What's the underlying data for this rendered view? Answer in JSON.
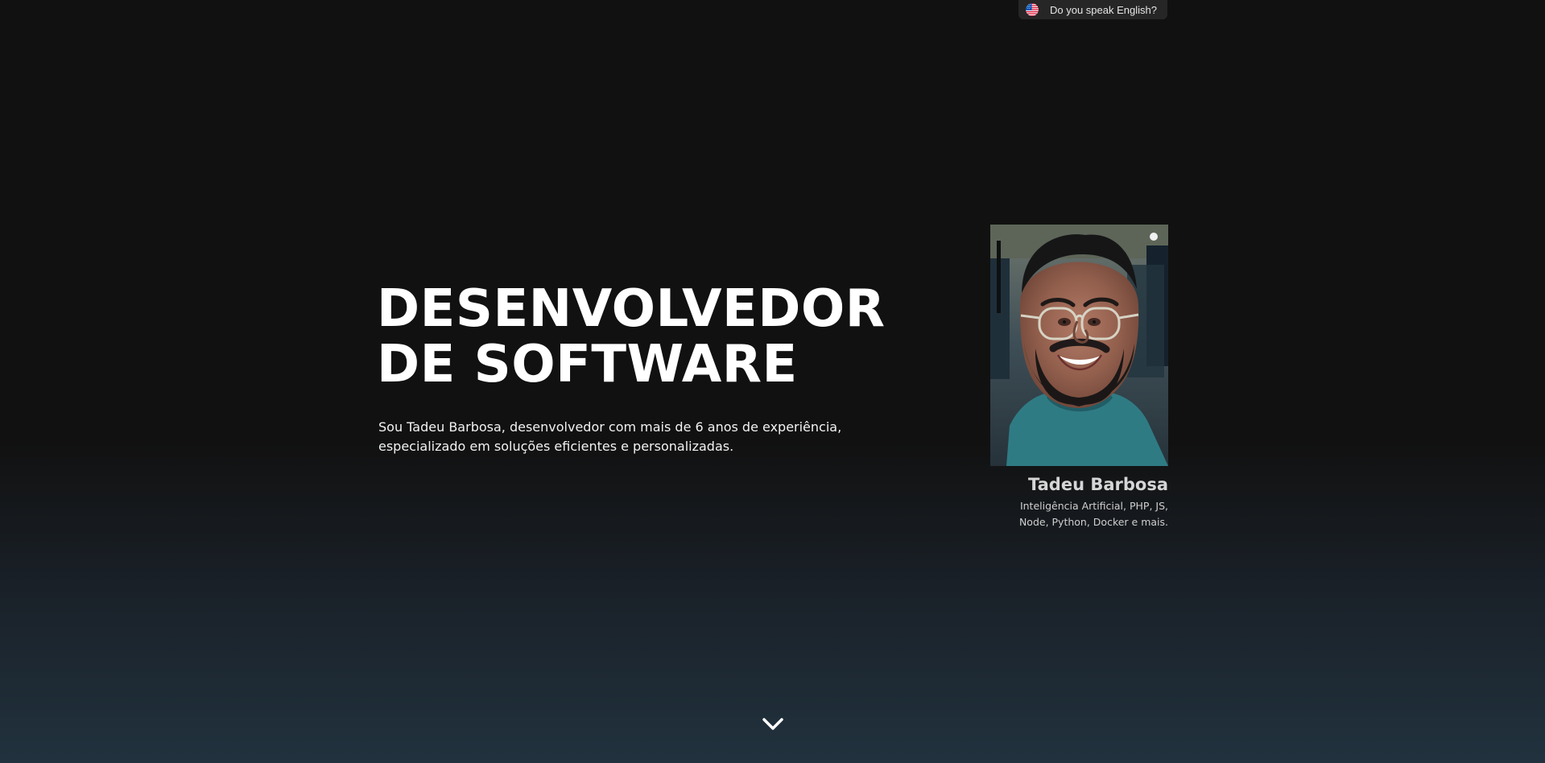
{
  "header": {
    "language_button_label": "Do you speak English?",
    "language_flag_icon": "us-flag-icon"
  },
  "hero": {
    "title_line_1": "DESENVOLVEDOR",
    "title_line_2": "DE SOFTWARE",
    "description": "Sou Tadeu Barbosa, desenvolvedor com mais de 6 anos de experiência, especializado em soluções eficientes e personalizadas."
  },
  "profile": {
    "photo_alt": "Tadeu Barbosa",
    "name": "Tadeu Barbosa",
    "skills": "Inteligência Artificial, PHP, JS, Node, Python, Docker e mais."
  },
  "scroll": {
    "icon": "chevron-down-icon"
  },
  "colors": {
    "background_top": "#111111",
    "background_bottom": "#21323e",
    "text": "#ffffff",
    "muted_text": "#cfcfcf",
    "language_button_bg": "#262626"
  }
}
